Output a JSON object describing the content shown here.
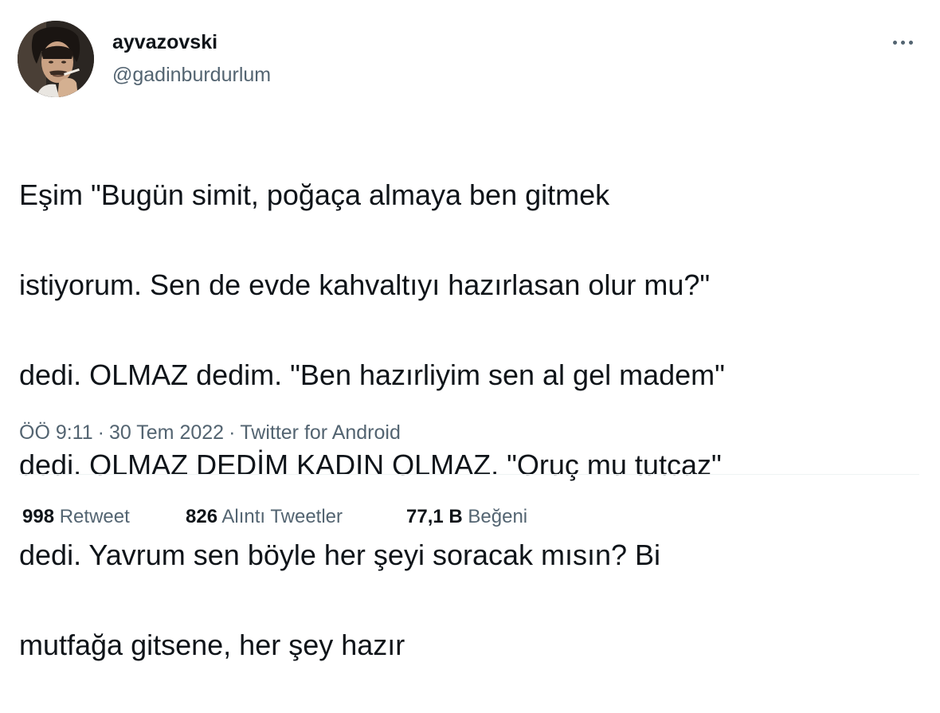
{
  "author": {
    "display_name": "ayvazovski",
    "handle": "@gadinburdurlum",
    "avatar_icon": "user-avatar"
  },
  "more_icon": "more-horizontal-icon",
  "tweet": {
    "text_lines": [
      "Eşim \"Bugün simit, poğaça almaya ben gitmek",
      "istiyorum. Sen de evde kahvaltıyı hazırlasan olur mu?\"",
      "dedi. OLMAZ dedim. \"Ben hazırliyim sen al gel madem\"",
      "dedi. OLMAZ DEDİM KADIN OLMAZ. \"Oruç mu tutcaz\"",
      "dedi. Yavrum sen böyle her şeyi soracak mısın? Bi",
      "mutfağa gitsene, her şey hazır"
    ]
  },
  "meta": {
    "time": "ÖÖ 9:11",
    "separator": "·",
    "date": "30 Tem 2022",
    "source": "Twitter for Android"
  },
  "stats": {
    "retweets": {
      "count": "998",
      "label": "Retweet"
    },
    "quotes": {
      "count": "826",
      "label": "Alıntı Tweetler"
    },
    "likes": {
      "count": "77,1 B",
      "label": "Beğeni"
    }
  },
  "colors": {
    "primary_text": "#0f1419",
    "secondary_text": "#536471",
    "divider": "#eff3f4"
  }
}
